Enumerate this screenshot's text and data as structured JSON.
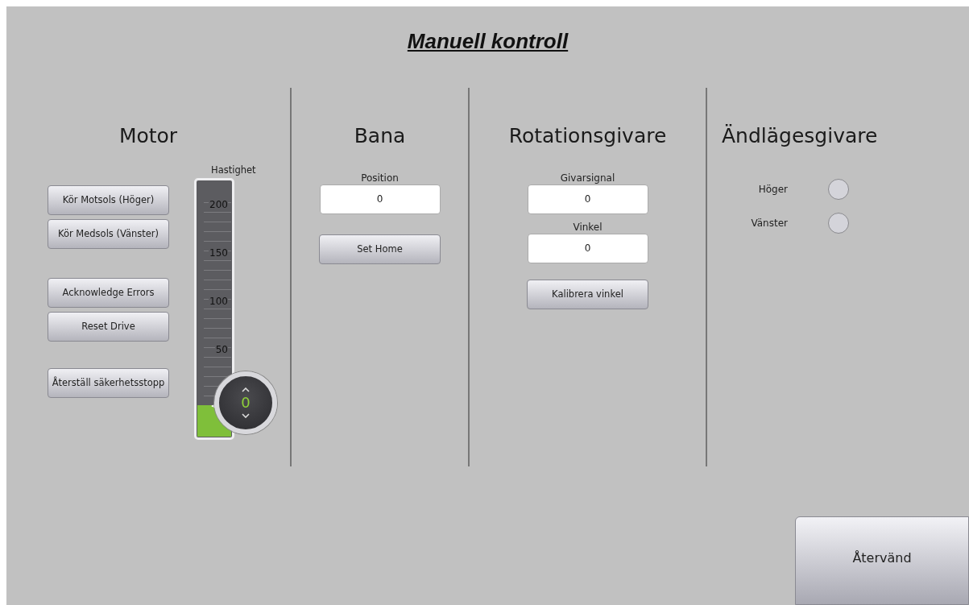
{
  "title": "Manuell kontroll",
  "motor": {
    "heading": "Motor",
    "button_groups": [
      [
        "Kör Motsols (Höger)",
        "Kör Medsols (Vänster)"
      ],
      [
        "Acknowledge Errors",
        "Reset Drive"
      ],
      [
        "Återställ säkerhetsstopp"
      ]
    ],
    "slider": {
      "label": "Hastighet",
      "ticks": [
        "200",
        "150",
        "100",
        "50"
      ],
      "level": 0,
      "value": "0"
    }
  },
  "bana": {
    "heading": "Bana",
    "fields": [
      {
        "label": "Position",
        "value": "0"
      }
    ],
    "button": "Set Home"
  },
  "rotation": {
    "heading": "Rotationsgivare",
    "fields": [
      {
        "label": "Givarsignal",
        "value": "0"
      },
      {
        "label": "Vinkel",
        "value": "0"
      }
    ],
    "button": "Kalibrera vinkel"
  },
  "limits": {
    "heading": "Ändlägesgivare",
    "sensors": [
      {
        "label": "Höger",
        "on": false
      },
      {
        "label": "Vänster",
        "on": false
      }
    ]
  },
  "back_button": "Återvänd"
}
